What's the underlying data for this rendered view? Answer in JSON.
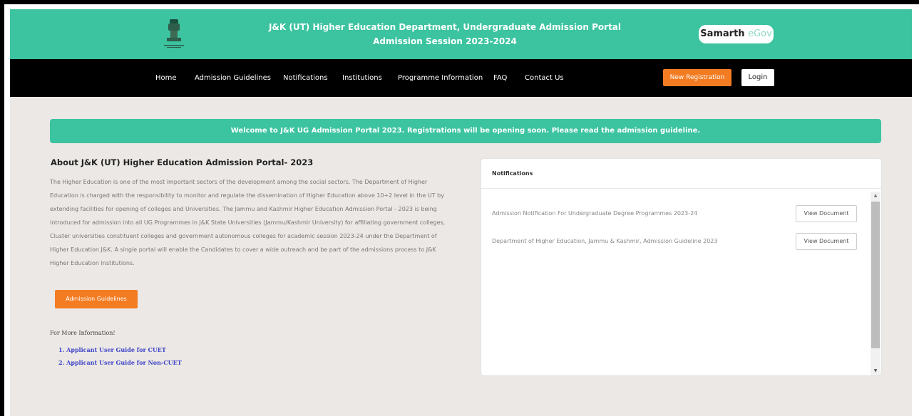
{
  "header": {
    "title_line1": "J&K (UT) Higher Education Department, Undergraduate Admission Portal",
    "title_line2": "Admission Session 2023-2024",
    "brand_main": "Samarth",
    "brand_sub": "eGov",
    "emblem_icon": "national-emblem-icon"
  },
  "nav": {
    "items": [
      "Home",
      "Admission Guidelines",
      "Notifications",
      "Institutions",
      "Programme Information",
      "FAQ",
      "Contact Us"
    ],
    "register_label": "New Registration",
    "login_label": "Login"
  },
  "banner": {
    "text": "Welcome to J&K UG Admission Portal 2023. Registrations will be opening soon. Please read the admission guideline."
  },
  "about": {
    "title": "About J&K (UT) Higher Education Admission Portal- 2023",
    "lines": [
      "The Higher Education is one of the most important sectors of the development among the social sectors. The Department of Higher",
      "Education is charged with the responsibility to monitor and regulate the dissemination of Higher Education above 10+2 level in the UT by",
      "extending facilities for opening of colleges and Universities. The Jammu and Kashmir Higher Education Admission Portal - 2023 is being",
      "introduced for admission into all UG Programmes in J&K State Universities (Jammu/Kashmir University) for affiliating government colleges,",
      "Cluster universities constituent colleges and government autonomous colleges for academic session 2023-24 under the Department of",
      "Higher Education J&K. A single portal will enable the Candidates to cover a wide outreach and be part of the admissions process to J&K",
      "Higher Education Institutions."
    ],
    "guidelines_button": "Admission Guidelines",
    "more_info_label": "For More Information!",
    "more_links": [
      "1. Applicant User Guide for CUET",
      "2. Applicant User Guide for Non-CUET"
    ]
  },
  "notifications": {
    "title": "Notifications",
    "items": [
      {
        "text": "Admission Notification For Undergraduate Degree Programmes 2023-24",
        "button": "View Document"
      },
      {
        "text": "Department of Higher Education, Jammu & Kashmir, Admission Guideline 2023",
        "button": "View Document"
      }
    ]
  },
  "colors": {
    "accent": "#3cc3a0",
    "orange": "#f37c22",
    "nav_bg": "#000000",
    "page_bg": "#ebe8e5",
    "link": "#3f44c8"
  }
}
